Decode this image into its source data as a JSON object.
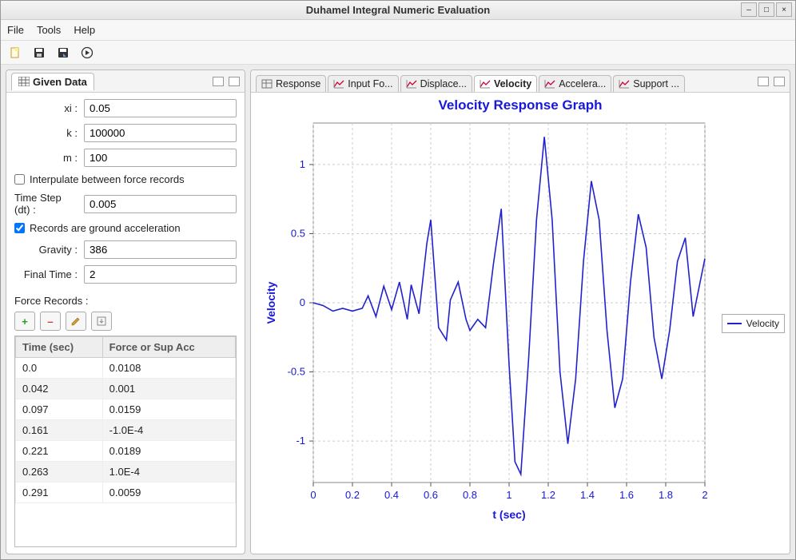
{
  "window": {
    "title": "Duhamel Integral Numeric Evaluation"
  },
  "menubar": {
    "file": "File",
    "tools": "Tools",
    "help": "Help"
  },
  "left": {
    "tab_label": "Given Data",
    "xi_label": "xi :",
    "xi": "0.05",
    "k_label": "k :",
    "k": "100000",
    "m_label": "m :",
    "m": "100",
    "interp_label": "Interpulate between force records",
    "dt_label": "Time Step (dt) :",
    "dt": "0.005",
    "ground_label": "Records are ground acceleration",
    "gravity_label": "Gravity :",
    "gravity": "386",
    "final_label": "Final Time :",
    "final": "2",
    "records_label": "Force Records :",
    "col_time": "Time (sec)",
    "col_force": "Force or Sup Acc",
    "rows": [
      {
        "t": "0.0",
        "f": "0.0108"
      },
      {
        "t": "0.042",
        "f": "0.001"
      },
      {
        "t": "0.097",
        "f": "0.0159"
      },
      {
        "t": "0.161",
        "f": "-1.0E-4"
      },
      {
        "t": "0.221",
        "f": "0.0189"
      },
      {
        "t": "0.263",
        "f": "1.0E-4"
      },
      {
        "t": "0.291",
        "f": "0.0059"
      }
    ]
  },
  "tabs": {
    "items": [
      {
        "label": "Response"
      },
      {
        "label": "Input Fo..."
      },
      {
        "label": "Displace..."
      },
      {
        "label": "Velocity"
      },
      {
        "label": "Accelera..."
      },
      {
        "label": "Support ..."
      }
    ],
    "active_index": 3
  },
  "chart_data": {
    "type": "line",
    "title": "Velocity Response Graph",
    "xlabel": "t (sec)",
    "ylabel": "Velocity",
    "xlim": [
      0,
      2
    ],
    "ylim": [
      -1.3,
      1.3
    ],
    "x_ticks": [
      0,
      0.2,
      0.4,
      0.6,
      0.8,
      1,
      1.2,
      1.4,
      1.6,
      1.8,
      2
    ],
    "y_ticks": [
      -1,
      -0.5,
      0,
      0.5,
      1
    ],
    "legend": [
      "Velocity"
    ],
    "series": [
      {
        "name": "Velocity",
        "x": [
          0,
          0.05,
          0.1,
          0.15,
          0.2,
          0.25,
          0.28,
          0.32,
          0.36,
          0.4,
          0.44,
          0.48,
          0.5,
          0.54,
          0.58,
          0.6,
          0.64,
          0.68,
          0.7,
          0.74,
          0.78,
          0.8,
          0.84,
          0.88,
          0.92,
          0.96,
          1.0,
          1.03,
          1.06,
          1.1,
          1.14,
          1.18,
          1.22,
          1.26,
          1.3,
          1.34,
          1.38,
          1.42,
          1.46,
          1.5,
          1.54,
          1.58,
          1.62,
          1.66,
          1.7,
          1.74,
          1.78,
          1.82,
          1.86,
          1.9,
          1.94,
          2.0
        ],
        "y": [
          0,
          -0.02,
          -0.06,
          -0.04,
          -0.06,
          -0.04,
          0.05,
          -0.1,
          0.12,
          -0.05,
          0.15,
          -0.12,
          0.13,
          -0.08,
          0.43,
          0.6,
          -0.18,
          -0.27,
          0.02,
          0.15,
          -0.12,
          -0.2,
          -0.12,
          -0.18,
          0.28,
          0.68,
          -0.45,
          -1.15,
          -1.24,
          -0.4,
          0.6,
          1.2,
          0.6,
          -0.5,
          -1.02,
          -0.55,
          0.3,
          0.88,
          0.6,
          -0.2,
          -0.76,
          -0.55,
          0.15,
          0.64,
          0.4,
          -0.25,
          -0.55,
          -0.2,
          0.3,
          0.47,
          -0.1,
          0.32
        ]
      }
    ]
  }
}
